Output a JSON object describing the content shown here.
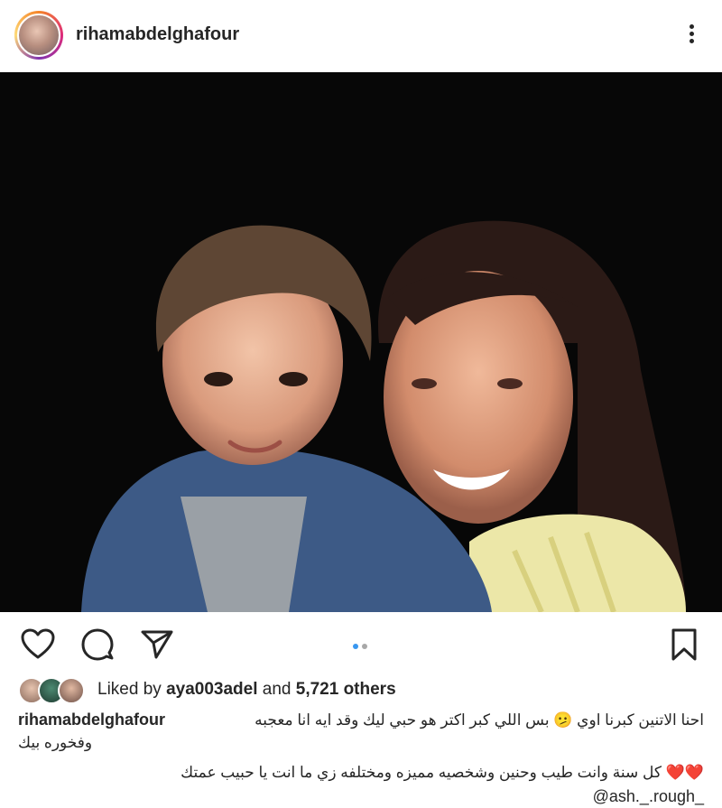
{
  "post": {
    "username": "rihamabdelghafour"
  },
  "carousel": {
    "total": 2,
    "active": 1,
    "active_color": "#3897f0",
    "inactive_color": "#a8a8a8"
  },
  "likes": {
    "prefix": "Liked by",
    "user": "aya003adel",
    "middle": "and",
    "count": "5,721 others"
  },
  "caption": {
    "username": "rihamabdelghafour",
    "line1": "احنا الاتنين كبرنا اوي 🫤 بس اللي كبر اكتر هو حبي ليك وقد ايه انا معجبه",
    "line2": "وفخوره بيك",
    "line3_text": "كل سنة وانت طيب وحنين وشخصيه  مميزه ومختلفه زي ما انت يا حبيب عمتك",
    "line3_hearts": "❤️❤️",
    "mention": "@ash._.rough_"
  },
  "icons": {
    "like": "heart-icon",
    "comment": "comment-icon",
    "share": "send-icon",
    "save": "bookmark-icon",
    "more": "more-vertical-icon"
  }
}
